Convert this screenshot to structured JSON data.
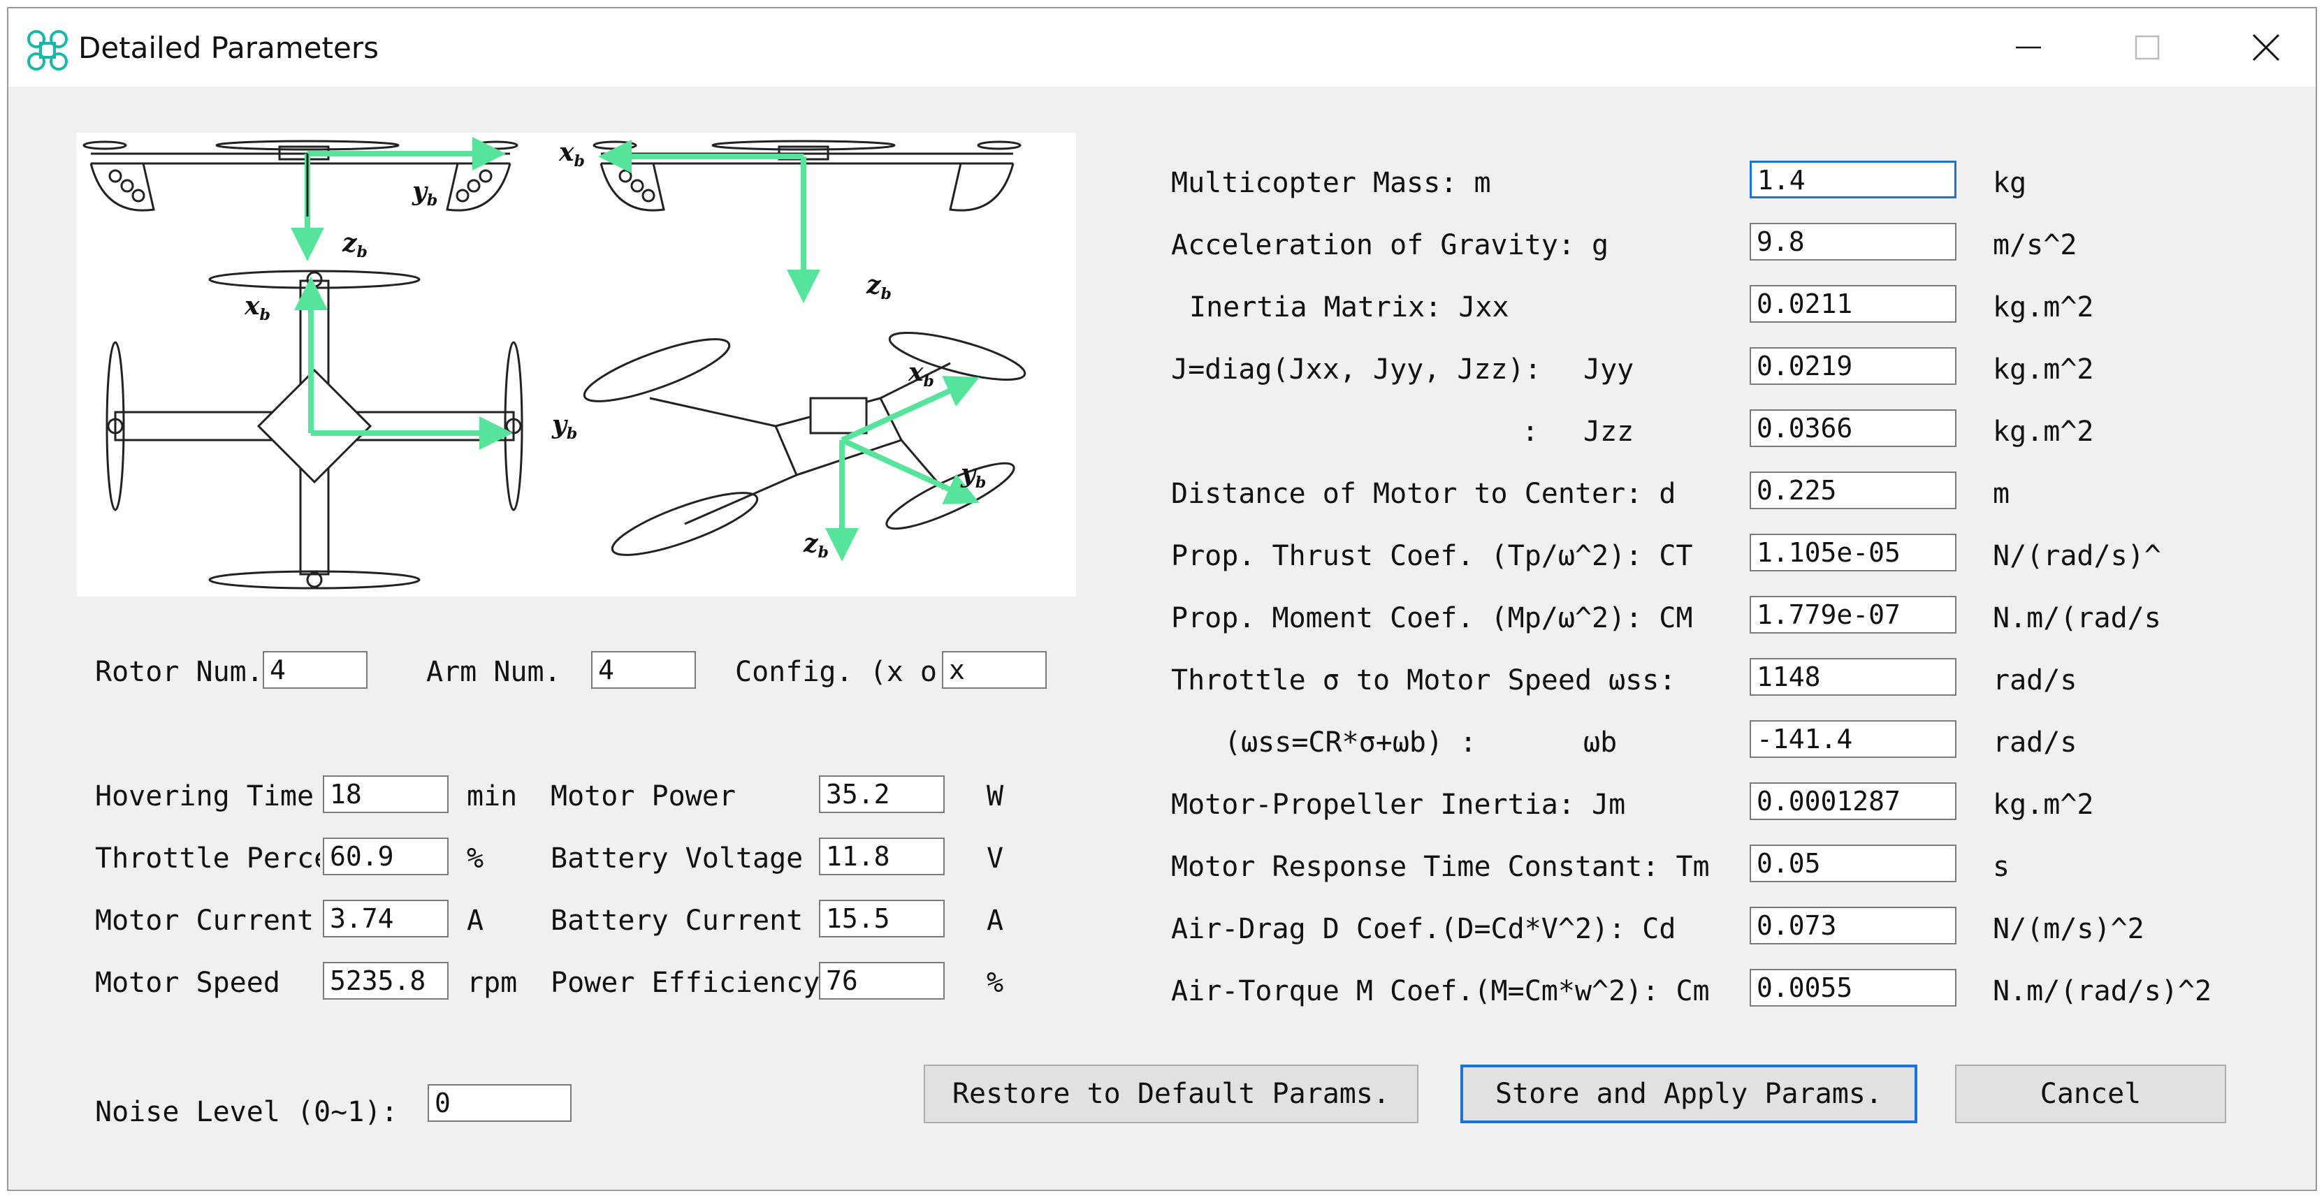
{
  "window": {
    "title": "Detailed Parameters"
  },
  "diagram": {
    "labels": {
      "xb": "x",
      "yb": "y",
      "zb": "z",
      "sub": "b"
    }
  },
  "left": {
    "rotor_num": {
      "label": "Rotor Num.",
      "value": "4"
    },
    "arm_num": {
      "label": "Arm Num.",
      "value": "4"
    },
    "config": {
      "label": "Config. (x o",
      "value": "x"
    },
    "hovering_time": {
      "label": "Hovering Time",
      "value": "18",
      "unit": "min"
    },
    "throttle_percent": {
      "label": "Throttle Perce",
      "value": "60.9",
      "unit": "%"
    },
    "motor_current": {
      "label": "Motor Current",
      "value": "3.74",
      "unit": "A"
    },
    "motor_speed": {
      "label": "Motor Speed",
      "value": "5235.8",
      "unit": "rpm"
    },
    "motor_power": {
      "label": "Motor Power",
      "value": "35.2",
      "unit": "W"
    },
    "battery_voltage": {
      "label": "Battery Voltage",
      "value": "11.8",
      "unit": "V"
    },
    "battery_current": {
      "label": "Battery Current",
      "value": "15.5",
      "unit": "A"
    },
    "power_efficiency": {
      "label": "Power Efficiency",
      "value": "76",
      "unit": "%"
    },
    "noise_level": {
      "label": "Noise Level (0~1):",
      "value": "0"
    }
  },
  "right": {
    "mass": {
      "label": "Multicopter Mass: m",
      "value": "1.4",
      "unit": "kg"
    },
    "gravity": {
      "label": "Acceleration of Gravity: g",
      "value": "9.8",
      "unit": "m/s^2"
    },
    "jxx": {
      "label": "Inertia Matrix: Jxx",
      "value": "0.0211",
      "unit": "kg.m^2"
    },
    "jyy": {
      "label": "J=diag(Jxx, Jyy, Jzz):",
      "sublabel": "Jyy",
      "value": "0.0219",
      "unit": "kg.m^2"
    },
    "jzz": {
      "label": ":",
      "sublabel": "Jzz",
      "value": "0.0366",
      "unit": "kg.m^2"
    },
    "distance": {
      "label": "Distance of Motor to Center: d",
      "value": "0.225",
      "unit": "m"
    },
    "thrust_coef": {
      "label": "Prop. Thrust Coef. (Tp/ω^2): CT",
      "value": "1.105e-05",
      "unit": "N/(rad/s)^"
    },
    "moment_coef": {
      "label": "Prop. Moment Coef. (Mp/ω^2): CM",
      "value": "1.779e-07",
      "unit": "N.m/(rad/s"
    },
    "throttle_speed": {
      "label": "Throttle σ to Motor Speed ωss:",
      "value": "1148",
      "unit": "rad/s"
    },
    "omega_b": {
      "label": "(ωss=CR*σ+ωb) :",
      "sublabel": "ωb",
      "value": "-141.4",
      "unit": "rad/s"
    },
    "jm": {
      "label": "Motor-Propeller Inertia: Jm",
      "value": "0.0001287",
      "unit": "kg.m^2"
    },
    "tm": {
      "label": "Motor Response Time Constant: Tm",
      "value": "0.05",
      "unit": "s"
    },
    "cd": {
      "label": "Air-Drag D Coef.(D=Cd*V^2): Cd",
      "value": "0.073",
      "unit": "N/(m/s)^2"
    },
    "cm": {
      "label": "Air-Torque M Coef.(M=Cm*w^2): Cm",
      "value": "0.0055",
      "unit": "N.m/(rad/s)^2"
    }
  },
  "buttons": {
    "restore": "Restore to Default Params.",
    "store": "Store and Apply Params.",
    "cancel": "Cancel"
  }
}
